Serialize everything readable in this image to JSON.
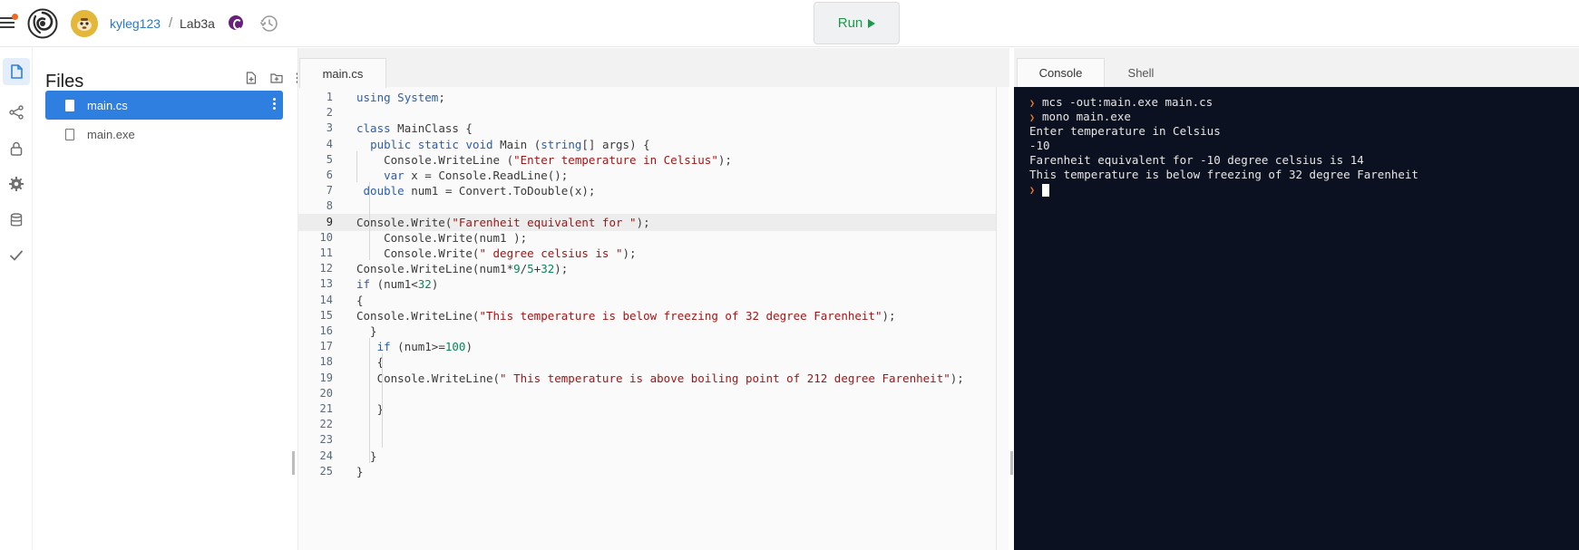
{
  "header": {
    "user": "kyleg123",
    "separator": "/",
    "repl_name": "Lab3a",
    "run_label": "Run"
  },
  "rail": {
    "items": [
      "files-icon",
      "version-control-icon",
      "lock-icon",
      "settings-icon",
      "database-icon",
      "check-icon"
    ]
  },
  "files": {
    "title": "Files",
    "items": [
      {
        "name": "main.cs",
        "selected": true
      },
      {
        "name": "main.exe",
        "selected": false
      }
    ]
  },
  "editor": {
    "tab": "main.cs",
    "current_line": 9,
    "lines": [
      "using System;",
      "",
      "class MainClass {",
      "  public static void Main (string[] args) {",
      "    Console.WriteLine (\"Enter temperature in Celsius\");",
      "    var x = Console.ReadLine();",
      " double num1 = Convert.ToDouble(x);",
      "",
      "Console.Write(\"Farenheit equivalent for \");",
      "    Console.Write(num1 );",
      "    Console.Write(\" degree celsius is \");",
      "Console.WriteLine(num1*9/5+32);",
      "if (num1<32)",
      "{",
      "Console.WriteLine(\"This temperature is below freezing of 32 degree Farenheit\");",
      "  }",
      "   if (num1>=100)",
      "   {",
      "   Console.WriteLine(\" This temperature is above boiling point of 212 degree Farenheit\");",
      "",
      "   }",
      "",
      "",
      "  }",
      "}"
    ]
  },
  "console": {
    "tabs": [
      "Console",
      "Shell"
    ],
    "active_tab": "Console",
    "lines": [
      {
        "prompt": true,
        "text": "mcs -out:main.exe main.cs"
      },
      {
        "prompt": true,
        "text": "mono main.exe"
      },
      {
        "prompt": false,
        "text": "Enter temperature in Celsius"
      },
      {
        "prompt": false,
        "text": "-10"
      },
      {
        "prompt": false,
        "text": "Farenheit equivalent for -10 degree celsius is 14"
      },
      {
        "prompt": false,
        "text": "This temperature is below freezing of 32 degree Farenheit"
      },
      {
        "prompt": true,
        "text": ""
      }
    ]
  },
  "colors": {
    "accent": "#2f7fe0",
    "run_green": "#1d9a4a",
    "terminal_bg": "#0c1121",
    "prompt_orange": "#f47a25",
    "notification": "#f26a21"
  }
}
